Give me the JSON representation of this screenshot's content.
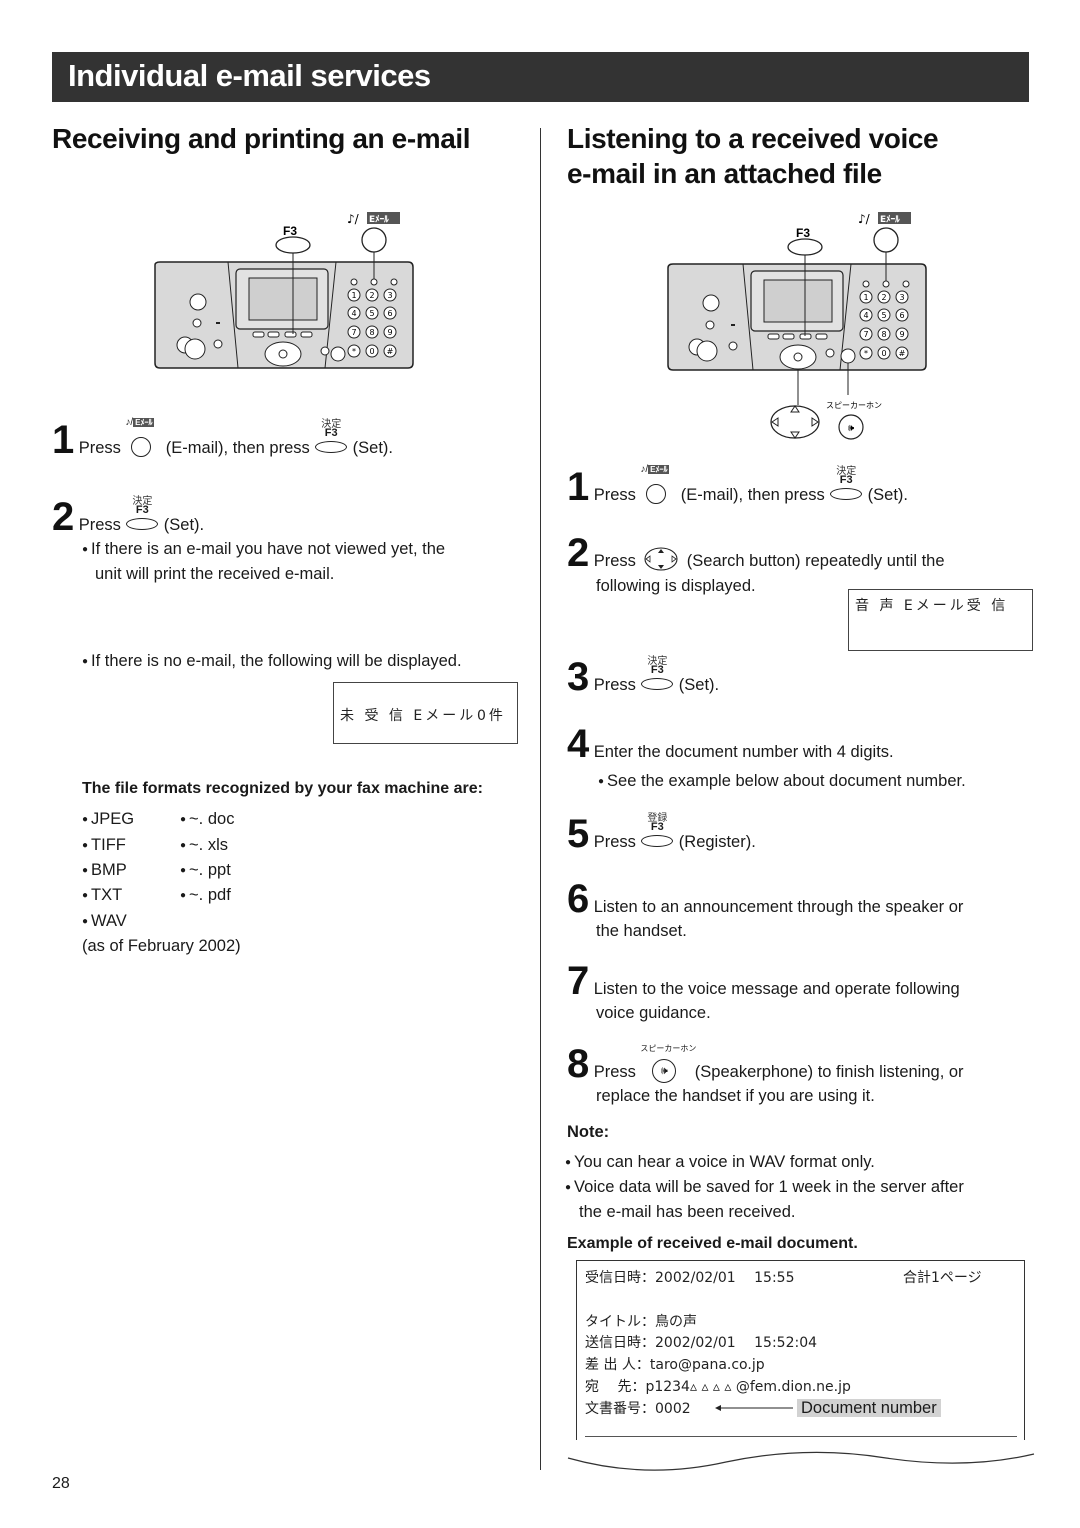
{
  "page": {
    "banner_title": "Individual e-mail services",
    "page_number": "28"
  },
  "left": {
    "heading": "Receiving and printing an e-mail",
    "diagram": {
      "f3_label": "F3",
      "email_key_label": "Eメール",
      "keypad": [
        "1",
        "2",
        "3",
        "4",
        "5",
        "6",
        "7",
        "8",
        "9",
        "∗",
        "0",
        "#"
      ]
    },
    "steps": [
      {
        "num": "1",
        "press": "Press",
        "key1_desc": "(E-mail), then press",
        "key2_kanji": "決定",
        "key2_label": "F3",
        "tail": "(Set)."
      },
      {
        "num": "2",
        "press": "Press",
        "key_kanji": "決定",
        "key_label": "F3",
        "tail": "(Set).",
        "bullet_line1": "If there is an e-mail you have not viewed yet, the",
        "bullet_line2": "unit will print the received e-mail."
      }
    ],
    "no_email_bullet": "If there is no e-mail, the following will be displayed.",
    "lcd_no_email": {
      "text": "未 受 信 Eメール",
      "count": "0件"
    },
    "formats_heading": "The file formats recognized by your fax machine are:",
    "formats_col1": [
      "JPEG",
      "TIFF",
      "BMP",
      "TXT",
      "WAV"
    ],
    "formats_col2": [
      "~. doc",
      "~. xls",
      "~. ppt",
      "~. pdf"
    ],
    "formats_note": "(as of February 2002)"
  },
  "right": {
    "heading_line1": "Listening to a received voice",
    "heading_line2": "e-mail in an attached file",
    "diagram": {
      "f3_label": "F3",
      "email_key_label": "Eメール",
      "speakerphone_label": "スピーカーホン",
      "keypad": [
        "1",
        "2",
        "3",
        "4",
        "5",
        "6",
        "7",
        "8",
        "9",
        "∗",
        "0",
        "#"
      ]
    },
    "steps": [
      {
        "num": "1",
        "press": "Press",
        "key1_desc": "(E-mail), then press",
        "key2_kanji": "決定",
        "key2_label": "F3",
        "tail": "(Set)."
      },
      {
        "num": "2",
        "press": "Press",
        "tail": "(Search button) repeatedly until the",
        "line2": "following is displayed."
      },
      {
        "num": "3",
        "press": "Press",
        "key_kanji": "決定",
        "key_label": "F3",
        "tail": "(Set)."
      },
      {
        "num": "4",
        "text": "Enter the document number with 4 digits.",
        "bullet": "See the example below about document number."
      },
      {
        "num": "5",
        "press": "Press",
        "key_kanji": "登録",
        "key_label": "F3",
        "tail": "(Register)."
      },
      {
        "num": "6",
        "line1": "Listen to an announcement through the speaker or",
        "line2": "the handset."
      },
      {
        "num": "7",
        "line1": "Listen to the voice message and operate following",
        "line2": "voice guidance."
      },
      {
        "num": "8",
        "press": "Press",
        "key_kanji": "スピーカーホン",
        "tail": "(Speakerphone) to finish listening, or",
        "line2": "replace the handset if you are using it."
      }
    ],
    "lcd_voice": "音 声 Eメール受 信",
    "note_heading": "Note:",
    "notes": [
      "You can hear a voice in WAV format only.",
      "Voice data will be saved for 1 week in the server after",
      "the e-mail has been received."
    ],
    "example_heading": "Example of received e-mail document.",
    "example_doc": {
      "received_label": "受信日時：",
      "received_value": "2002/02/01　 15:55",
      "total_pages": "合計1ページ",
      "title_label": "タイトル：",
      "title_value": "鳥の声",
      "sent_label": "送信日時：",
      "sent_value": "2002/02/01　 15:52:04",
      "from_label": "差 出 人：",
      "from_value": "taro@pana.co.jp",
      "to_label": "宛　 先：",
      "to_value": "p1234▵ ▵ ▵ ▵ @fem.dion.ne.jp",
      "docnum_label": "文書番号：",
      "docnum_value": "0002",
      "docnum_callout": "Document number"
    }
  }
}
